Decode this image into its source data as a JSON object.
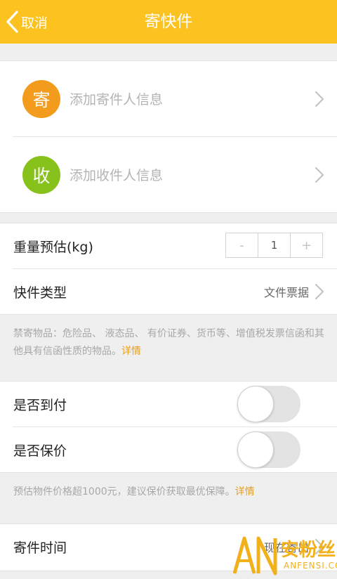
{
  "header": {
    "back_label": "取消",
    "title": "寄快件"
  },
  "contacts": {
    "sender": {
      "badge": "寄",
      "text": "添加寄件人信息",
      "color": "#f39b1c"
    },
    "receiver": {
      "badge": "收",
      "text": "添加收件人信息",
      "color": "#86c11c"
    }
  },
  "weight": {
    "label": "重量预估(kg)",
    "minus": "-",
    "value": "1",
    "plus": "+"
  },
  "type": {
    "label": "快件类型",
    "value": "文件票据"
  },
  "prohibited_note": {
    "text": "禁寄物品：危险品、 液态品、 有价证券、货币等、增值税发票信函和其他具有信函性质的物品。",
    "link": "详情"
  },
  "cod": {
    "label": "是否到付",
    "on": false
  },
  "insure": {
    "label": "是否保价",
    "on": false
  },
  "insure_note": {
    "text": "预估物件价格超1000元，建议保价获取最优保障。",
    "link": "详情"
  },
  "send_time": {
    "label": "寄件时间",
    "value": "现在寄出"
  },
  "watermark": {
    "cn": "安粉丝",
    "en": "ANFENSI.COM"
  },
  "colors": {
    "brand_yellow": "#fcc21f",
    "link_orange": "#e8a01c"
  }
}
